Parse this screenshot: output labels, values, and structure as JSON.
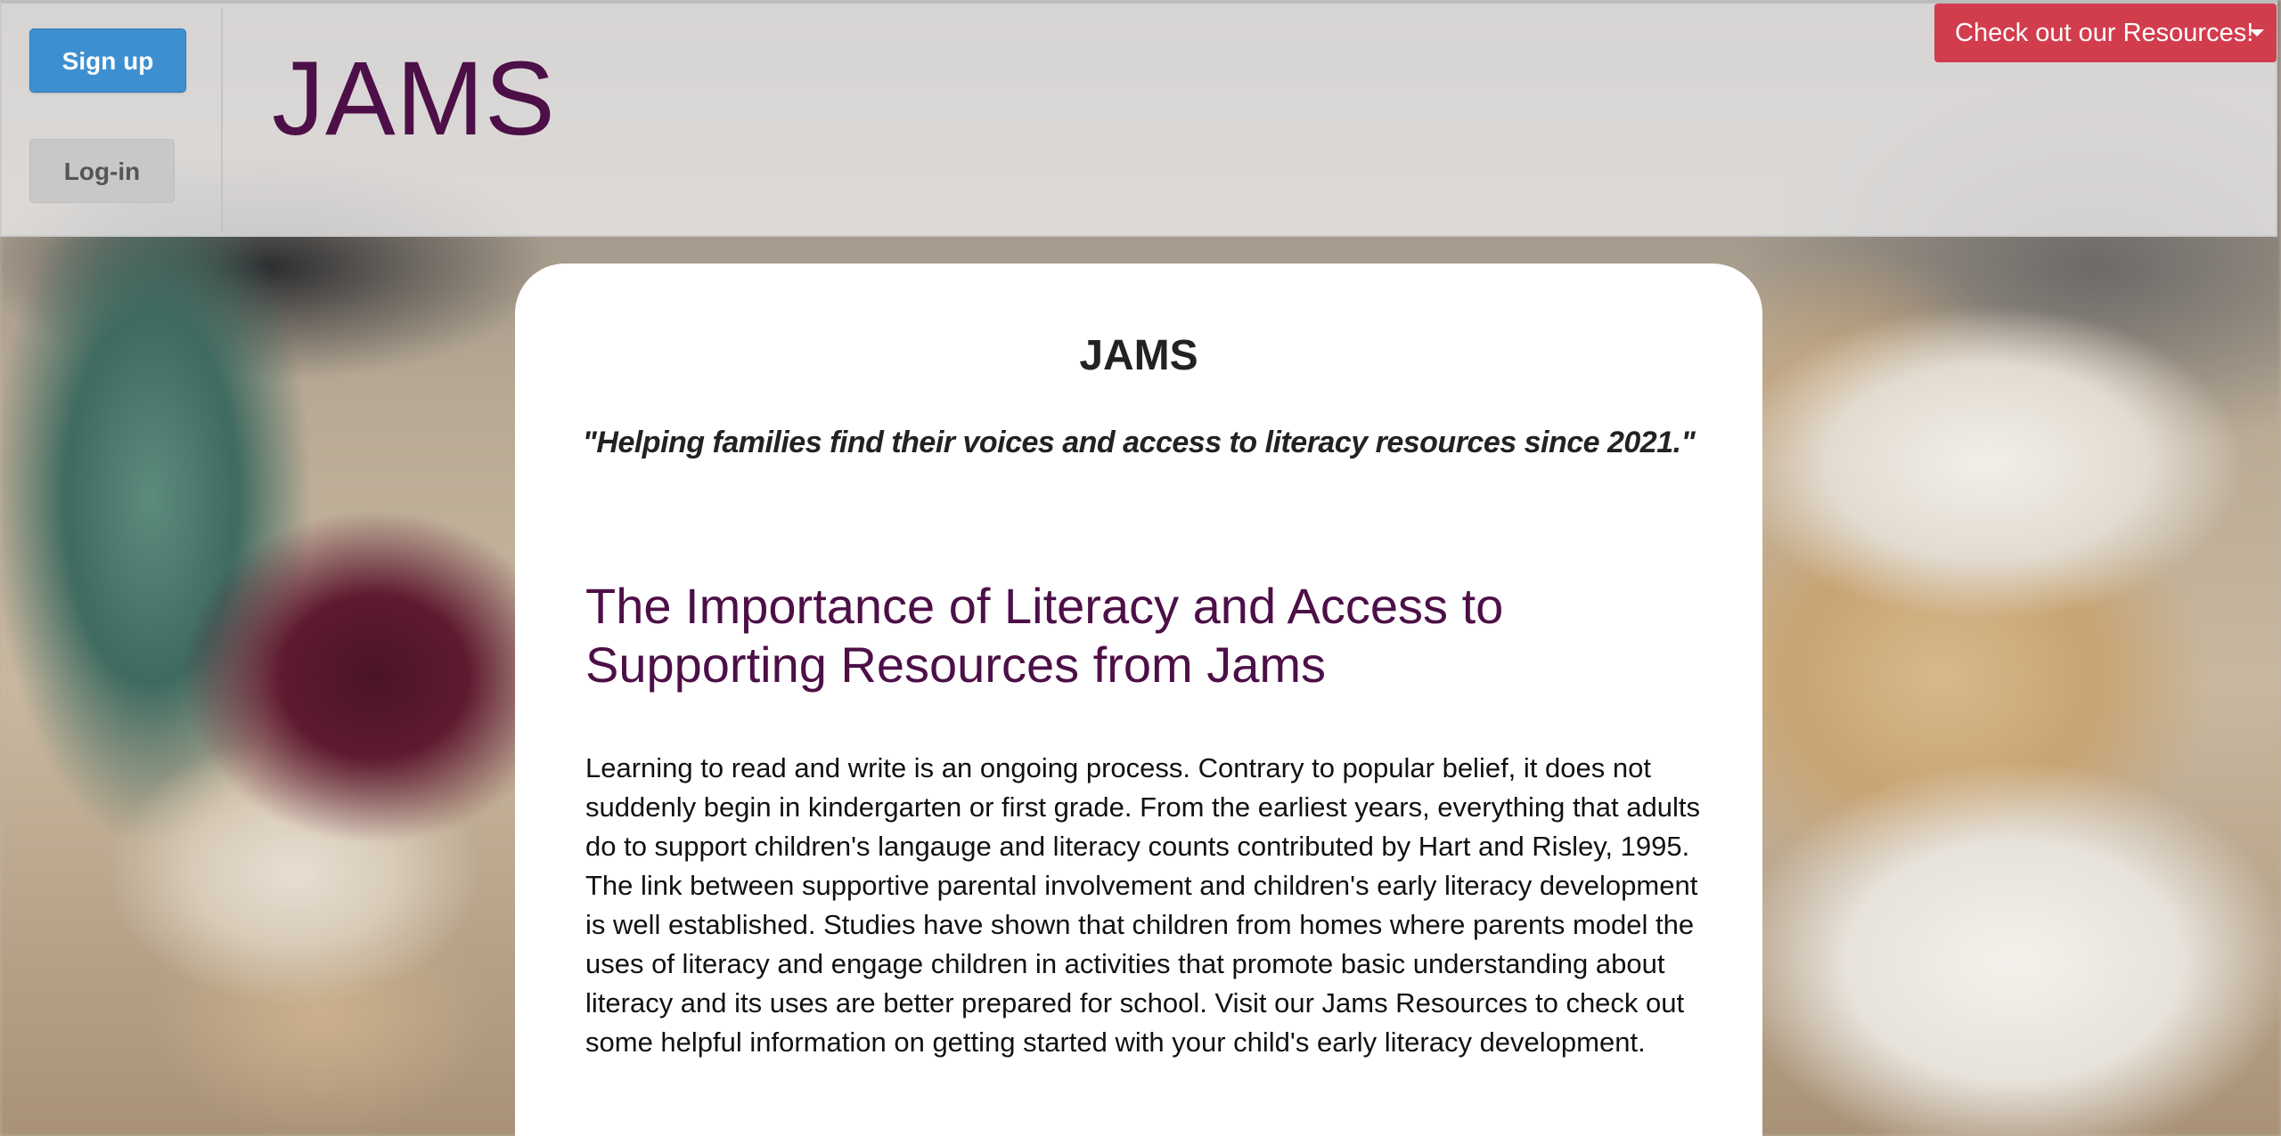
{
  "header": {
    "signup_label": "Sign up",
    "login_label": "Log-in",
    "site_title": "JAMS",
    "resources_label": "Check out our Resources!"
  },
  "main": {
    "title": "JAMS",
    "tagline": "\"Helping families find their voices and access to literacy resources since 2021.\"",
    "heading": "The Importance of Literacy and Access to Supporting Resources from Jams",
    "paragraph": "Learning to read and write is an ongoing process. Contrary to popular belief, it does not suddenly begin in kindergarten or first grade. From the earliest years, everything that adults do to support children's langauge and literacy counts contributed by Hart and Risley, 1995. The link between supportive parental involvement and children's early literacy development is well established. Studies have shown that children from homes where parents model the uses of literacy and engage children in activities that promote basic understanding about literacy and its uses are better prepared for school. Visit our Jams Resources to check out some helpful information on getting started with your child's early literacy development."
  },
  "colors": {
    "brand_purple": "#4d0f47",
    "signup_blue": "#3d8fd0",
    "resources_red": "#d23d4e",
    "login_gray": "#c8c8c8"
  },
  "icons": {
    "resources_caret": "caret-down-icon"
  }
}
